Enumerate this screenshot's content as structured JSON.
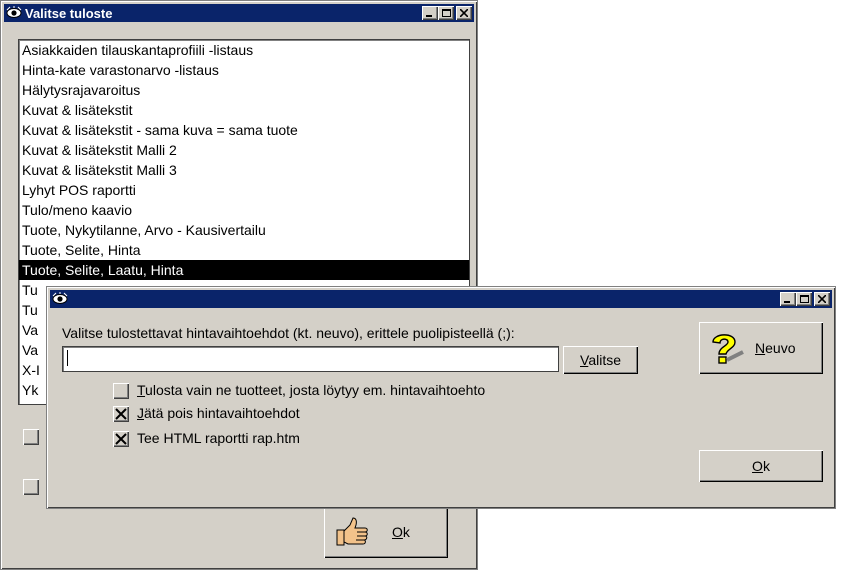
{
  "back_window": {
    "title": "Valitse tuloste",
    "title_icon": "eye-icon",
    "list_items": [
      "Asiakkaiden tilauskantaprofiili -listaus",
      "Hinta-kate varastonarvo -listaus",
      "Hälytysrajavaroitus",
      "Kuvat & lisätekstit",
      "Kuvat & lisätekstit - sama kuva = sama tuote",
      "Kuvat & lisätekstit Malli 2",
      "Kuvat & lisätekstit Malli 3",
      "Lyhyt POS raportti",
      "Tulo/meno kaavio",
      "Tuote, Nykytilanne, Arvo - Kausivertailu",
      "Tuote, Selite, Hinta",
      "Tuote, Selite, Laatu, Hinta",
      "Tu",
      "Tu",
      "Va",
      "Va",
      "X-I",
      "Yk"
    ],
    "selected_index": 11,
    "ok_button": {
      "mnemonic": "O",
      "rest": "k",
      "icon": "thumbs-up-icon"
    }
  },
  "front_dialog": {
    "title": "",
    "title_icon": "eye-icon",
    "prompt": "Valitse tulostettavat hintavaihtoehdot (kt. neuvo), erittele puolipisteellä (;):",
    "input_value": "",
    "select_button": {
      "mnemonic": "V",
      "rest": "alitse"
    },
    "help_button": {
      "mnemonic": "N",
      "rest": "euvo",
      "icon": "question-mark-icon"
    },
    "ok_button": {
      "mnemonic": "O",
      "rest": "k"
    },
    "checkboxes": [
      {
        "mnemonic": "T",
        "rest": "ulosta vain ne tuotteet, josta löytyy em. hintavaihtoehto",
        "checked": false
      },
      {
        "mnemonic": "J",
        "rest": "ätä pois hintavaihtoehdot",
        "checked": true
      },
      {
        "mnemonic": "",
        "rest": "Tee HTML raportti rap.htm",
        "checked": true
      }
    ]
  }
}
